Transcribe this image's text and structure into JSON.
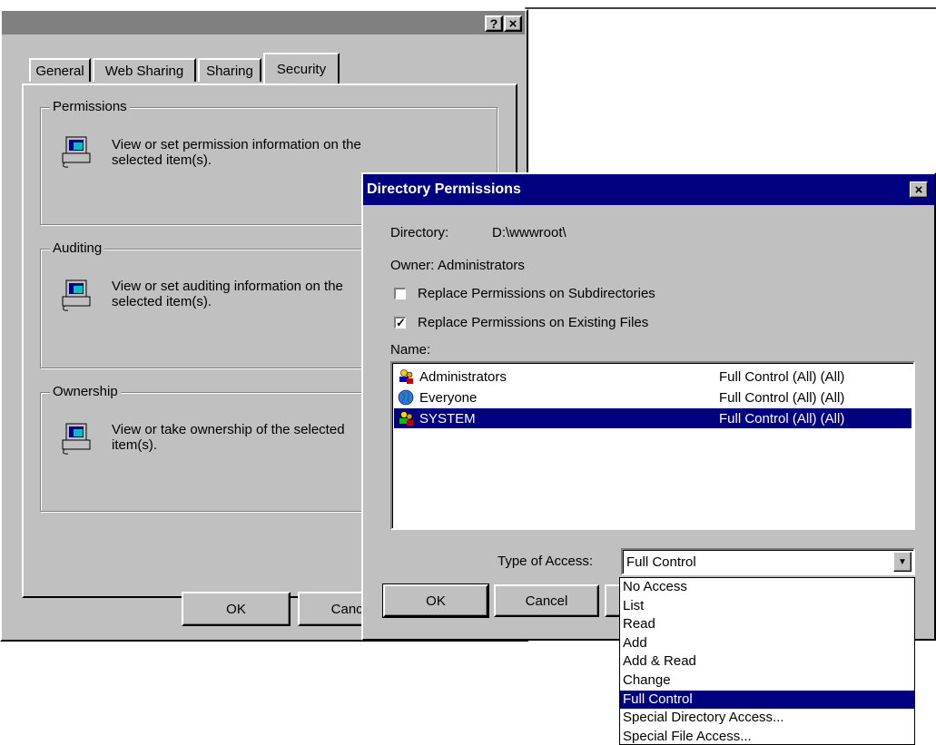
{
  "back_dialog": {
    "title_buttons": [
      "?",
      "×"
    ],
    "tabs": [
      {
        "label": "General"
      },
      {
        "label": "Web Sharing"
      },
      {
        "label": "Sharing"
      },
      {
        "label": "Security"
      }
    ],
    "groups": {
      "permissions": {
        "legend": "Permissions",
        "text": "View or set permission information on the selected item(s)."
      },
      "auditing": {
        "legend": "Auditing",
        "text": "View or set auditing information on the selected item(s)."
      },
      "ownership": {
        "legend": "Ownership",
        "text": "View or take ownership of the selected item(s)."
      }
    },
    "ok_label": "OK",
    "cancel_label": "Cancel"
  },
  "dir_dialog": {
    "title": "Directory Permissions",
    "close_glyph": "×",
    "directory_label": "Directory:",
    "directory_value": "D:\\wwwroot\\",
    "owner_label": "Owner:",
    "owner_value": "Administrators",
    "replace_subdirs_label": "Replace Permissions on Subdirectories",
    "replace_subdirs_checked": false,
    "replace_files_label": "Replace Permissions on Existing Files",
    "replace_files_checked": true,
    "check_mark": "✓",
    "name_label": "Name:",
    "entries": [
      {
        "name": "Administrators",
        "access": "Full Control (All) (All)",
        "icon": "group-icon",
        "selected": false
      },
      {
        "name": "Everyone",
        "access": "Full Control (All) (All)",
        "icon": "globe-icon",
        "selected": false
      },
      {
        "name": "SYSTEM",
        "access": "Full Control (All) (All)",
        "icon": "group-icon",
        "selected": true
      }
    ],
    "type_of_access_label": "Type of Access:",
    "type_of_access_value": "Full Control",
    "dropdown_arrow": "▼",
    "ok_label": "OK",
    "cancel_label": "Cancel",
    "access_options": [
      {
        "label": "No Access"
      },
      {
        "label": "List"
      },
      {
        "label": "Read"
      },
      {
        "label": "Add"
      },
      {
        "label": "Add & Read"
      },
      {
        "label": "Change"
      },
      {
        "label": "Full Control",
        "selected": true
      },
      {
        "label": "Special Directory Access..."
      },
      {
        "label": "Special File Access..."
      }
    ]
  },
  "colors": {
    "face": "#c0c0c0",
    "titlebar": "#000080",
    "highlight": "#000080",
    "window": "#ffffff"
  }
}
